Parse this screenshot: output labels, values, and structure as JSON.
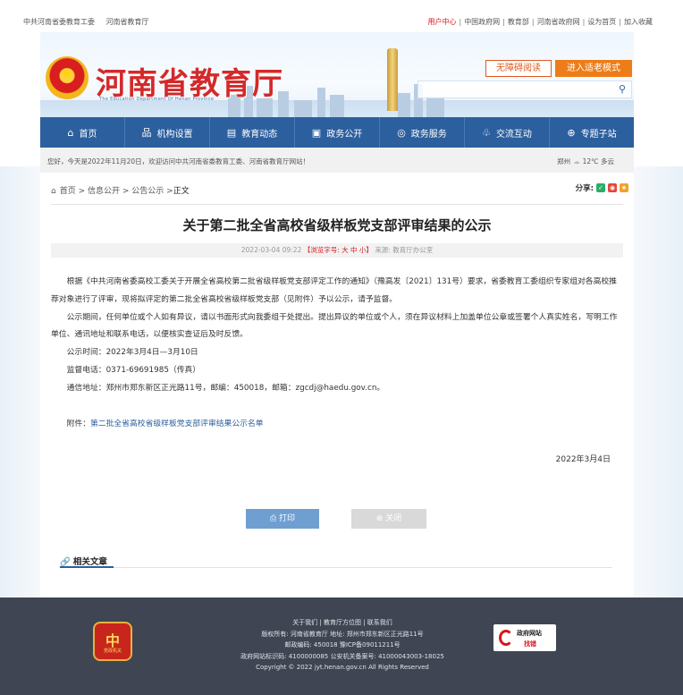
{
  "topbar": {
    "left": [
      "中共河南省委教育工委",
      "河南省教育厅"
    ],
    "right": [
      "用户中心",
      "中国政府网",
      "教育部",
      "河南省政府网",
      "设为首页",
      "加入收藏"
    ]
  },
  "header": {
    "logo_title": "河南省教育厅",
    "logo_sub": "The Education Department Of Henan Province",
    "accessible_label": "无障碍阅读",
    "elder_mode_label": "进入适老模式",
    "search_placeholder": ""
  },
  "nav": [
    {
      "icon": "home-icon",
      "glyph": "⌂",
      "label": "首页"
    },
    {
      "icon": "org-icon",
      "glyph": "品",
      "label": "机构设置"
    },
    {
      "icon": "news-icon",
      "glyph": "▤",
      "label": "教育动态"
    },
    {
      "icon": "gov-icon",
      "glyph": "▣",
      "label": "政务公开"
    },
    {
      "icon": "service-icon",
      "glyph": "◎",
      "label": "政务服务"
    },
    {
      "icon": "chat-icon",
      "glyph": "♧",
      "label": "交流互动"
    },
    {
      "icon": "topic-icon",
      "glyph": "⊕",
      "label": "专题子站"
    }
  ],
  "welcome": {
    "text": "您好，今天是2022年11月20日，欢迎访问中共河南省委教育工委、河南省教育厅网站！",
    "city": "郑州",
    "weather": "12℃ 多云"
  },
  "breadcrumb": [
    "首页",
    "信息公开",
    "公告公示",
    "正文"
  ],
  "share_label": "分享:",
  "article": {
    "title": "关于第二批全省高校省级样板党支部评审结果的公示",
    "meta_date": "2022-03-04 09:22",
    "meta_font": "【浏览字号: 大 中 小】",
    "meta_source": "来源: 教育厅办公室",
    "paragraphs": [
      "根据《中共河南省委高校工委关于开展全省高校第二批省级样板党支部评定工作的通知》（豫高发〔2021〕131号）要求，省委教育工委组织专家组对各高校推荐对象进行了评审，现将拟评定的第二批全省高校省级样板党支部（见附件）予以公示，请予监督。",
      "公示期间，任何单位或个人如有异议，请以书面形式向我委组干处提出。提出异议的单位或个人，须在异议材料上加盖单位公章或签署个人真实姓名，写明工作单位、通讯地址和联系电话，以便核实查证后及时反馈。",
      "公示时间：2022年3月4日—3月10日",
      "监督电话：0371-69691985（传真）",
      "通信地址：郑州市郑东新区正光路11号，邮编：450018，邮箱：zgcdj@haedu.gov.cn。"
    ],
    "attachment_label": "附件：",
    "attachment_link": "第二批全省高校省级样板党支部评审结果公示名单",
    "date": "2022年3月4日"
  },
  "actions": {
    "print_label": "打印",
    "close_label": "关闭"
  },
  "related": {
    "title": "相关文章"
  },
  "footer": {
    "badge_char": "中",
    "badge_text": "党政机关",
    "lines": [
      "关于我们 | 教育厅方位图 | 联系我们",
      "版权所有: 河南省教育厅 地址: 郑州市郑东新区正光路11号",
      "邮政编码: 450018 豫ICP备09011211号",
      "政府网站标识码: 4100000085 公安机关备案号: 41000043003-18025",
      "Copyright © 2022 jyt.henan.gov.cn All Rights Reserved"
    ],
    "gov_mark_title": "政府网站",
    "gov_mark_sub": "找错"
  },
  "colors": {
    "nav_blue": "#2c5f9e",
    "brand_red": "#d6171e",
    "elder_orange": "#ed7d18",
    "footer_bg": "#3f4552"
  }
}
